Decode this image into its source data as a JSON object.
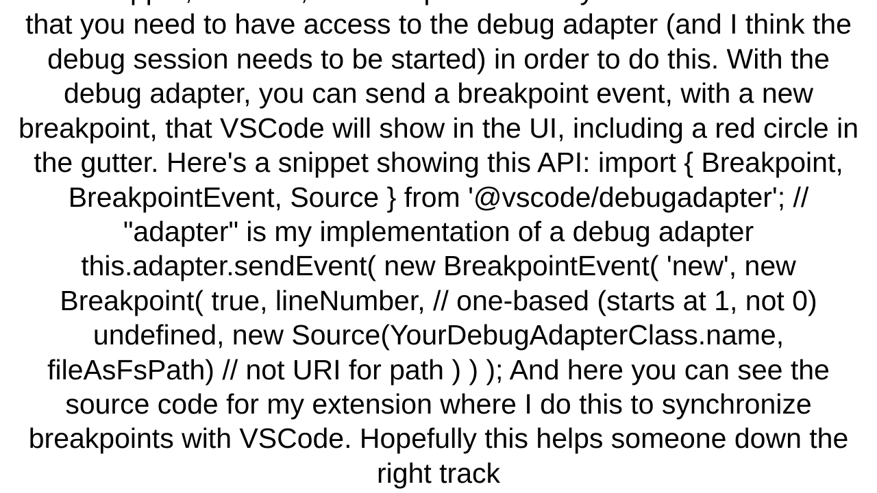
{
  "content": {
    "text": "code snippet, one tool, one component at any other. One caveat is that you need to have access to the debug adapter (and I think the debug session needs to be started) in order to do this. With the debug adapter, you can send a breakpoint event, with a new breakpoint, that VSCode will show in the UI, including a red circle in the gutter. Here's a snippet showing this API: import { Breakpoint, BreakpointEvent, Source } from '@vscode/debugadapter';  // \"adapter\" is my implementation of a debug adapter this.adapter.sendEvent(   new BreakpointEvent(     'new',     new Breakpoint(       true,       lineNumber, // one-based (starts at 1, not 0)       undefined,       new Source(YourDebugAdapterClass.name, fileAsFsPath) // not URI for path     )   ) );  And here you can see the source code for my extension where I do this to synchronize breakpoints with VSCode. Hopefully this helps someone down the right track"
  }
}
